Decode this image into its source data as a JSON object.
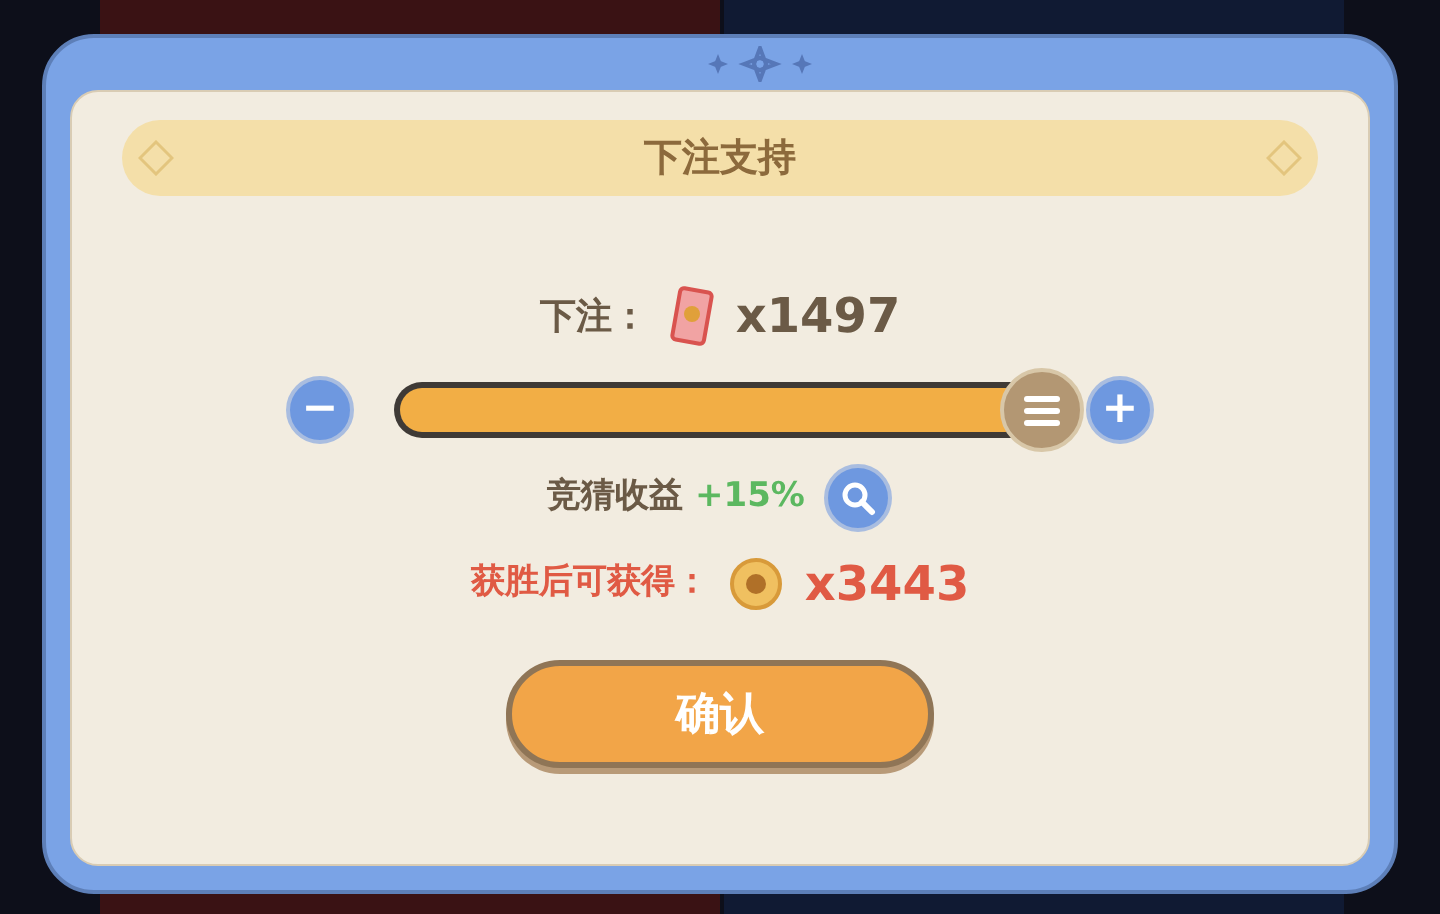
{
  "dialog": {
    "title": "下注支持"
  },
  "bet": {
    "label": "下注：",
    "amount": "x1497"
  },
  "slider": {
    "level": 0.96,
    "minus": "−",
    "plus": "+"
  },
  "odds": {
    "label": "竞猜收益",
    "value": "+15%"
  },
  "reward": {
    "label": "获胜后可获得：",
    "amount": "x3443"
  },
  "buttons": [
    "确认"
  ]
}
